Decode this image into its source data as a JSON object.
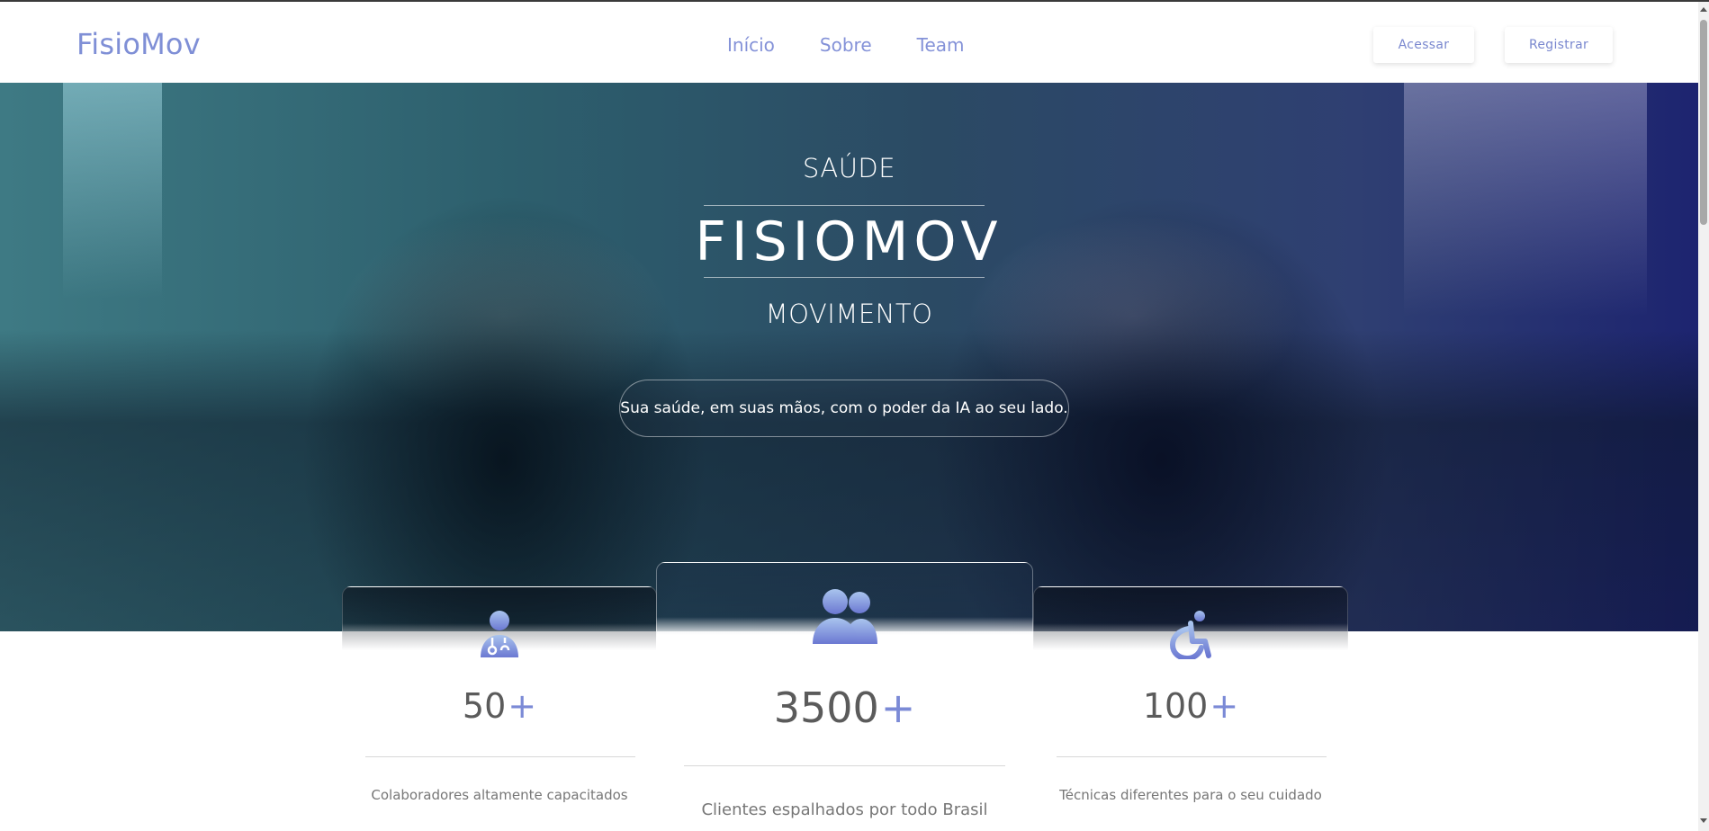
{
  "nav": {
    "brand": "FisioMov",
    "links": [
      "Início",
      "Sobre",
      "Team"
    ],
    "login_label": "Acessar",
    "register_label": "Registrar"
  },
  "hero": {
    "kicker_top": "SAÚDE",
    "title": "FISIOMOV",
    "kicker_bottom": "MOVIMENTO",
    "tagline": "Sua saúde, em suas mãos, com o poder da IA ao seu lado."
  },
  "stats": [
    {
      "icon": "doctor-icon",
      "number": "50",
      "suffix": "+",
      "description": "Colaboradores altamente capacitados"
    },
    {
      "icon": "users-icon",
      "number": "3500",
      "suffix": "+",
      "description": "Clientes espalhados por todo Brasil"
    },
    {
      "icon": "wheelchair-icon",
      "number": "100",
      "suffix": "+",
      "description": "Técnicas diferentes para o seu cuidado"
    }
  ],
  "colors": {
    "accent": "#7f8fd6",
    "stat_text": "#5b5b5b",
    "description_text": "#777777"
  }
}
